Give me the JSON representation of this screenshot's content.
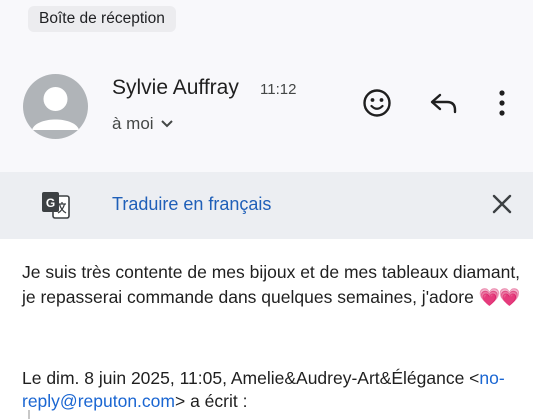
{
  "labels": {
    "chip": "Boîte de réception"
  },
  "message": {
    "sender_name": "Sylvie Auffray",
    "time": "11:12",
    "recipient": "à moi",
    "avatar_icon": "person-icon"
  },
  "actions": {
    "emoji_icon": "emoji-reaction-icon",
    "reply_icon": "reply-icon",
    "more_icon": "more-vert-icon"
  },
  "translate": {
    "icon": "google-translate-icon",
    "link_label": "Traduire en français",
    "close_icon": "close-icon"
  },
  "body": {
    "text": "Je suis très contente de mes bijoux et de mes tableaux diamant, je repasserai commande dans quelques semaines, j'adore",
    "emoji": "💗💗"
  },
  "quote": {
    "header_prefix": "Le dim. 8 juin 2025, 11:05, Amelie&Audrey-Art&Élégance <",
    "email": "no-reply@reputon.com",
    "header_suffix": "> a écrit :"
  },
  "colors": {
    "link": "#1f5fb8",
    "top_background": "#f8f8fb",
    "translate_bar": "#eceef2",
    "hearts": "#f0397a"
  }
}
